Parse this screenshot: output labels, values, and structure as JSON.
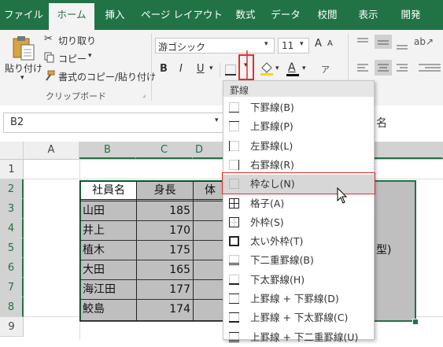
{
  "ribbon_tabs": [
    "ファイル",
    "ホーム",
    "挿入",
    "ページ レイアウト",
    "数式",
    "データ",
    "校閲",
    "表示",
    "開発"
  ],
  "clipboard": {
    "paste_label": "貼り付け",
    "cut_label": "切り取り",
    "copy_label": "コピー",
    "format_painter_label": "書式のコピー/貼り付け",
    "group_label": "クリップボード"
  },
  "font": {
    "name": "游ゴシック",
    "size": "11",
    "bold": "B",
    "italic": "I",
    "underline": "U",
    "font_color_glyph": "A"
  },
  "name_box": "B2",
  "formula_partial": "名",
  "columns": [
    "A",
    "B",
    "C",
    "D"
  ],
  "rows": [
    "1",
    "2",
    "3",
    "4",
    "5",
    "6",
    "7",
    "8",
    "9"
  ],
  "table": {
    "headers": [
      "社員名",
      "身長",
      "体"
    ],
    "rows": [
      {
        "name": "山田",
        "height": "185"
      },
      {
        "name": "井上",
        "height": "170"
      },
      {
        "name": "植木",
        "height": "175"
      },
      {
        "name": "大田",
        "height": "165"
      },
      {
        "name": "海江田",
        "height": "177"
      },
      {
        "name": "鮫島",
        "height": "174"
      }
    ],
    "partial_right": "型)"
  },
  "border_menu": {
    "header": "罫線",
    "items": [
      {
        "label": "下罫線(B)",
        "icon": "border-bottom-icon"
      },
      {
        "label": "上罫線(P)",
        "icon": "border-top-icon"
      },
      {
        "label": "左罫線(L)",
        "icon": "border-left-icon"
      },
      {
        "label": "右罫線(R)",
        "icon": "border-right-icon"
      },
      {
        "label": "枠なし(N)",
        "icon": "no-border-icon"
      },
      {
        "label": "格子(A)",
        "icon": "all-borders-icon"
      },
      {
        "label": "外枠(S)",
        "icon": "outside-borders-icon"
      },
      {
        "label": "太い外枠(T)",
        "icon": "thick-outside-borders-icon"
      },
      {
        "label": "下二重罫線(B)",
        "icon": "bottom-double-border-icon"
      },
      {
        "label": "下太罫線(H)",
        "icon": "thick-bottom-border-icon"
      },
      {
        "label": "上罫線 + 下罫線(D)",
        "icon": "top-bottom-border-icon"
      },
      {
        "label": "上罫線 + 下太罫線(C)",
        "icon": "top-thick-bottom-border-icon"
      },
      {
        "label": "上罫線 + 下二重罫線(U)",
        "icon": "top-double-bottom-border-icon"
      }
    ],
    "highlighted_index": 4
  },
  "colors": {
    "excel_green": "#217346",
    "highlight_red": "#e03030",
    "selection_gray": "#bfbfbf"
  }
}
